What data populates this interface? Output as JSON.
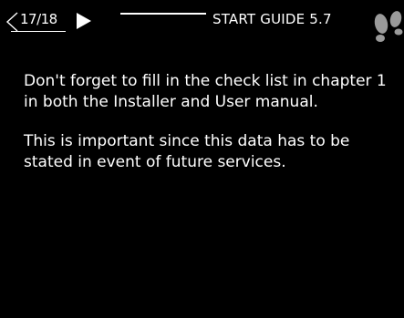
{
  "header": {
    "page_counter": "17/18",
    "title": "START GUIDE 5.7"
  },
  "message": {
    "paragraph_1": "Don't forget to fill in the check list in chapter 1 in both the Installer and User manual.",
    "paragraph_2": "This is important since this data has to be stated in event of future services."
  },
  "colors": {
    "background": "#000000",
    "foreground": "#ffffff",
    "icon": "#9a9a9a"
  },
  "icons": {
    "prev": "left-arrow-outline-icon",
    "next": "right-arrow-filled-icon",
    "guide": "footprints-icon"
  }
}
